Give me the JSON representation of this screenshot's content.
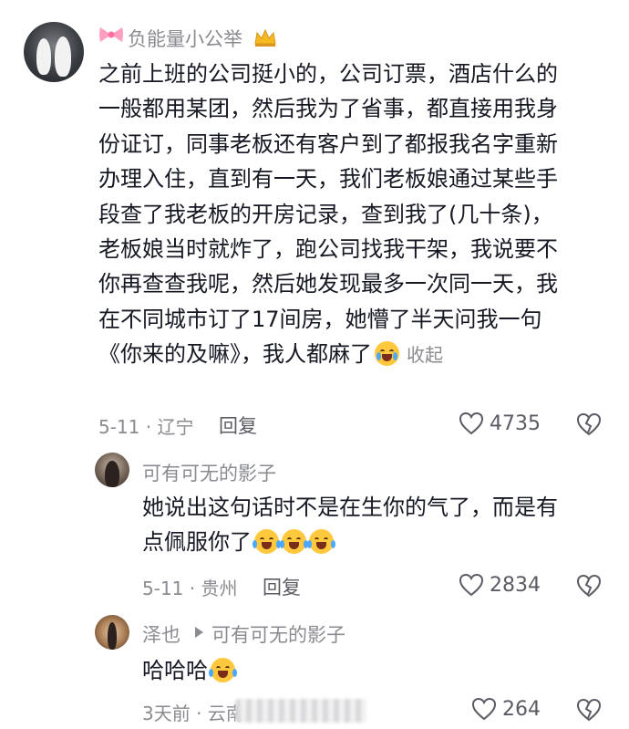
{
  "comment_main": {
    "username": "负能量小公举",
    "lines": [
      "之前上班的公司挺小的，公司订票，酒店什么的",
      "一般都用某团，然后我为了省事，都直接用我身",
      "份证订，同事老板还有客户到了都报我名字重新",
      "办理入住，直到有一天，我们老板娘通过某些手",
      "段查了我老板的开房记录，查到我了(几十条)，",
      "老板娘当时就炸了，跑公司找我干架，我说要不",
      "你再查查我呢，然后她发现最多一次同一天，我",
      "在不同城市订了17间房，她懵了半天问我一句",
      "《你来的及嘛》，我人都麻了"
    ],
    "collapse_label": "收起",
    "meta": "5-11 · 辽宁",
    "reply_label": "回复",
    "like_count": "4735"
  },
  "reply_1": {
    "username": "可有可无的影子",
    "lines": [
      "她说出这句话时不是在生你的气了，而是有",
      "点佩服你了"
    ],
    "meta": "5-11 · 贵州",
    "reply_label": "回复",
    "like_count": "2834"
  },
  "reply_2": {
    "username": "泽也",
    "reply_to": "可有可无的影子",
    "text": "哈哈哈",
    "meta": "3天前 · 云南",
    "like_count": "264"
  },
  "icons": {
    "like": "heart-outline-icon",
    "dislike": "broken-heart-icon",
    "reply_arrow": "triangle-right-icon",
    "emoji": "crying-laughing-emoji"
  },
  "colors": {
    "text": "#161823",
    "secondary": "#8a8b91"
  }
}
